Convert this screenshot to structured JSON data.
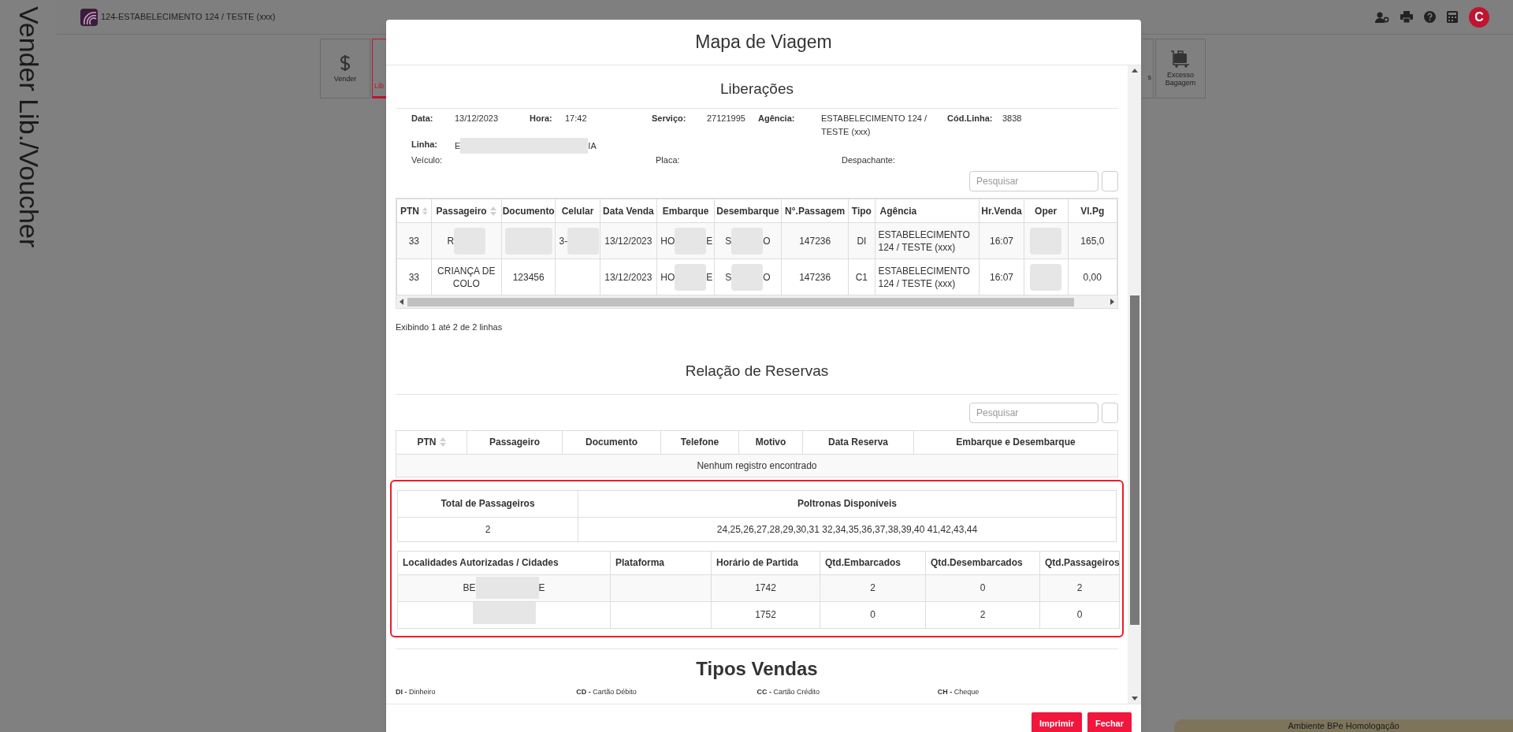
{
  "side_title": "Vender Lib./Voucher",
  "topbar": {
    "title": "124-ESTABELECIMENTO 124 / TESTE (xxx)",
    "avatar": "C"
  },
  "toolbar": [
    {
      "label": "Vender",
      "kind": "dollar",
      "selected": false
    },
    {
      "label": "Lib",
      "kind": "partial",
      "selected": true
    },
    {
      "label": "s",
      "kind": "partial_right",
      "selected": false
    },
    {
      "label": "Excesso Bagagem",
      "kind": "luggage",
      "selected": false
    }
  ],
  "modal": {
    "title": "Mapa de Viagem",
    "liberacoes": {
      "title": "Liberações",
      "info": [
        [
          {
            "label": "Data:",
            "value": "13/12/2023"
          },
          {
            "label": "Hora:",
            "value": "17:42"
          },
          {
            "label": "Serviço:",
            "value": "27121995"
          },
          {
            "label": "Agência:",
            "value": "ESTABELECIMENTO 124 / TESTE (xxx)"
          },
          {
            "label": "Cód.Linha:",
            "value": "3838"
          }
        ],
        [
          {
            "label": "Linha:",
            "fragments": [
              "E",
              "IA"
            ]
          }
        ],
        [
          {
            "label": "Veículo:"
          },
          {
            "label": "Placa:"
          },
          {
            "label": "Despachante:"
          }
        ]
      ],
      "search": {
        "placeholder": "Pesquisar"
      },
      "columns": [
        {
          "label": "PTN",
          "sortable": true
        },
        {
          "label": "Passageiro",
          "sortable": true
        },
        {
          "label": "Documento",
          "sortable": false
        },
        {
          "label": "Celular",
          "sortable": false
        },
        {
          "label": "Data Venda",
          "sortable": false
        },
        {
          "label": "Embarque",
          "sortable": false
        },
        {
          "label": "Desembarque",
          "sortable": false
        },
        {
          "label": "N°.Passagem",
          "sortable": false
        },
        {
          "label": "Tipo",
          "sortable": false
        },
        {
          "label": "Agência",
          "sortable": false
        },
        {
          "label": "Hr.Venda",
          "sortable": false
        },
        {
          "label": "Oper",
          "sortable": false
        },
        {
          "label": "Vl.Pg",
          "sortable": false
        }
      ],
      "rows": [
        [
          "33",
          {
            "fragments": [
              "R"
            ]
          },
          {
            "blurred": true
          },
          {
            "fragments": [
              "3-"
            ]
          },
          "13/12/2023",
          {
            "fragments": [
              "HO",
              "E"
            ]
          },
          {
            "fragments": [
              "S",
              "O"
            ]
          },
          "147236",
          "DI",
          "ESTABELECIMENTO 124 / TESTE (xxx)",
          "16:07",
          {
            "blurred": true
          },
          "165,0"
        ],
        [
          "33",
          "CRIANÇA DE COLO",
          "123456",
          "",
          "13/12/2023",
          {
            "fragments": [
              "HO",
              "E"
            ]
          },
          {
            "fragments": [
              "S",
              "O"
            ]
          },
          "147236",
          "C1",
          "ESTABELECIMENTO 124 / TESTE (xxx)",
          "16:07",
          {
            "blurred": true
          },
          "0,00"
        ]
      ],
      "footer": "Exibindo 1 até 2 de 2 linhas"
    },
    "reservas": {
      "title": "Relação de Reservas",
      "search": {
        "placeholder": "Pesquisar"
      },
      "columns": [
        {
          "label": "PTN",
          "sortable": true
        },
        {
          "label": "Passageiro",
          "sortable": false
        },
        {
          "label": "Documento",
          "sortable": false
        },
        {
          "label": "Telefone",
          "sortable": false
        },
        {
          "label": "Motivo",
          "sortable": false
        },
        {
          "label": "Data Reserva",
          "sortable": false
        },
        {
          "label": "Embarque e Desembarque",
          "sortable": false
        }
      ],
      "empty": "Nenhum registro encontrado"
    },
    "summary": {
      "columns": [
        "Total de Passageiros",
        "Poltronas Disponíveis"
      ],
      "values": [
        "2",
        "24,25,26,27,28,29,30,31 32,34,35,36,37,38,39,40 41,42,43,44"
      ]
    },
    "localidades": {
      "columns": [
        "Localidades Autorizadas / Cidades",
        "Plataforma",
        "Horário de Partida",
        "Qtd.Embarcados",
        "Qtd.Desembarcados",
        "Qtd.Passageiros"
      ],
      "rows": [
        [
          {
            "fragments": [
              "BE",
              "E"
            ]
          },
          "",
          "1742",
          "2",
          "0",
          "2"
        ],
        [
          {
            "blurred": true
          },
          "",
          "1752",
          "0",
          "2",
          "0"
        ]
      ]
    },
    "tipos": {
      "title": "Tipos Vendas",
      "items": [
        "**DI -** Dinheiro",
        "**CD -** Cartão Débito",
        "**CC -** Cartão Crédito",
        "**CH -** Cheque"
      ]
    },
    "buttons": [
      "Imprimir",
      "Fechar"
    ]
  },
  "environment": "Ambiente BPe Homologação"
}
